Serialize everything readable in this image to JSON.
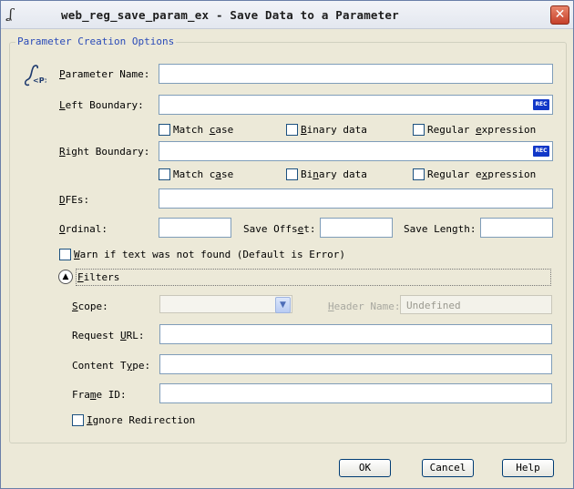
{
  "window": {
    "title": "web_reg_save_param_ex - Save Data to a Parameter",
    "close_glyph": "✕"
  },
  "group": {
    "legend": "Parameter Creation Options",
    "icon_text": "<P>"
  },
  "fields": {
    "parameter_name": {
      "label_mnemonic": "P",
      "label_rest": "arameter Name:",
      "value": ""
    },
    "left_boundary": {
      "label_mnemonic": "L",
      "label_rest": "eft Boundary:",
      "value": "",
      "badge": "REC"
    },
    "right_boundary": {
      "label_mnemonic": "R",
      "label_rest": "ight Boundary:",
      "value": "",
      "badge": "REC"
    },
    "dfes": {
      "label_mnemonic": "D",
      "label_rest": "FEs:",
      "value": ""
    },
    "ordinal": {
      "label_mnemonic": "O",
      "label_rest": "rdinal:",
      "value": ""
    },
    "save_offset": {
      "label_pre": "Save Offs",
      "label_mnemonic": "e",
      "label_rest": "t:",
      "value": ""
    },
    "save_length": {
      "label": "Save Length:",
      "value": ""
    }
  },
  "left_options": {
    "match_case": {
      "pre": "Match ",
      "mnemonic": "c",
      "rest": "ase"
    },
    "binary_data": {
      "pre": "",
      "mnemonic": "B",
      "rest": "inary data"
    },
    "regex": {
      "pre": "Regular ",
      "mnemonic": "e",
      "rest": "xpression"
    }
  },
  "right_options": {
    "match_case": {
      "pre": "Match c",
      "mnemonic": "a",
      "rest": "se"
    },
    "binary_data": {
      "pre": "Bi",
      "mnemonic": "n",
      "rest": "ary data"
    },
    "regex": {
      "pre": "Regular e",
      "mnemonic": "x",
      "rest": "pression"
    }
  },
  "warn": {
    "mnemonic": "W",
    "rest": "arn if text was not found (Default is Error)"
  },
  "filters": {
    "toggle_glyph": "▲",
    "label_mnemonic": "F",
    "label_rest": "ilters",
    "scope": {
      "label_mnemonic": "S",
      "label_rest": "cope:",
      "value": "",
      "arrow": "▼"
    },
    "header_name": {
      "label_mnemonic": "H",
      "label_rest": "eader Name:",
      "value": "Undefined"
    },
    "request_url": {
      "label_pre": "Request ",
      "label_mnemonic": "U",
      "label_rest": "RL:",
      "value": ""
    },
    "content_type": {
      "label_pre": "Content T",
      "label_mnemonic": "y",
      "label_rest": "pe:",
      "value": ""
    },
    "frame_id": {
      "label_pre": "Fra",
      "label_mnemonic": "m",
      "label_rest": "e ID:",
      "value": ""
    },
    "ignore_redirection": {
      "mnemonic": "I",
      "rest": "gnore Redirection"
    }
  },
  "buttons": {
    "ok": "OK",
    "cancel": "Cancel",
    "help": "Help"
  }
}
